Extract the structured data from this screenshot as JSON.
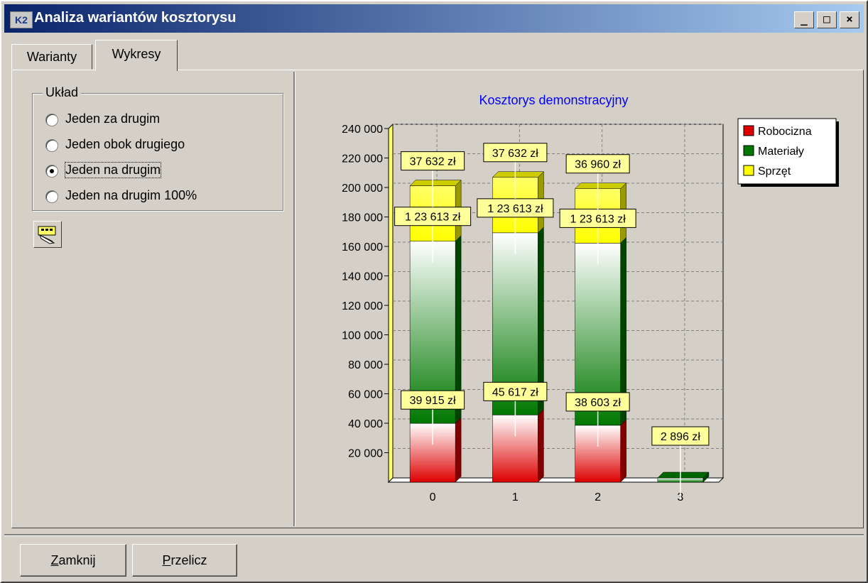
{
  "window": {
    "title": "Analiza wariantów kosztorysu",
    "icon_text": "K2"
  },
  "tabs": [
    {
      "label": "Warianty"
    },
    {
      "label": "Wykresy"
    }
  ],
  "layout_group": {
    "legend": "Układ",
    "options": [
      {
        "label": "Jeden za drugim",
        "selected": false
      },
      {
        "label": "Jeden obok drugiego",
        "selected": false
      },
      {
        "label": "Jeden na drugim",
        "selected": true
      },
      {
        "label": "Jeden na drugim 100%",
        "selected": false
      }
    ]
  },
  "buttons": {
    "close_label": "Zamknij",
    "close_mnemonic": "Z",
    "close_rest": "amknij",
    "recalc_label": "Przelicz",
    "recalc_mnemonic": "P",
    "recalc_rest": "rzelicz"
  },
  "colors": {
    "title_start": "#0a246a",
    "title_end": "#a6caf0",
    "labor": "#dd0000",
    "materials": "#007700",
    "equipment": "#ffff00",
    "label_bg": "#ffff99",
    "chart_title": "#0000ff"
  },
  "chart_data": {
    "type": "bar",
    "stacked": true,
    "title": "Kosztorys demonstracyjny",
    "categories": [
      "0",
      "1",
      "2",
      "3"
    ],
    "ylim": [
      0,
      240000
    ],
    "yticks": [
      "20 000",
      "40 000",
      "60 000",
      "80 000",
      "100 000",
      "120 000",
      "140 000",
      "160 000",
      "180 000",
      "200 000",
      "220 000",
      "240 000"
    ],
    "legend_position": "top-right",
    "grid": true,
    "series": [
      {
        "name": "Robocizna",
        "color": "#dd0000",
        "values": [
          39915,
          45617,
          38603,
          0
        ],
        "labels": [
          "39 915 zł",
          "45 617 zł",
          "38 603 zł",
          ""
        ]
      },
      {
        "name": "Materiały",
        "color": "#007700",
        "values": [
          123613,
          123613,
          123613,
          2896
        ],
        "labels": [
          "1 23 613 zł",
          "1 23 613 zł",
          "1 23 613 zł",
          "2 896 zł"
        ]
      },
      {
        "name": "Sprzęt",
        "color": "#ffff00",
        "values": [
          37632,
          37632,
          36960,
          0
        ],
        "labels": [
          "37 632 zł",
          "37 632 zł",
          "36 960 zł",
          ""
        ]
      }
    ]
  }
}
